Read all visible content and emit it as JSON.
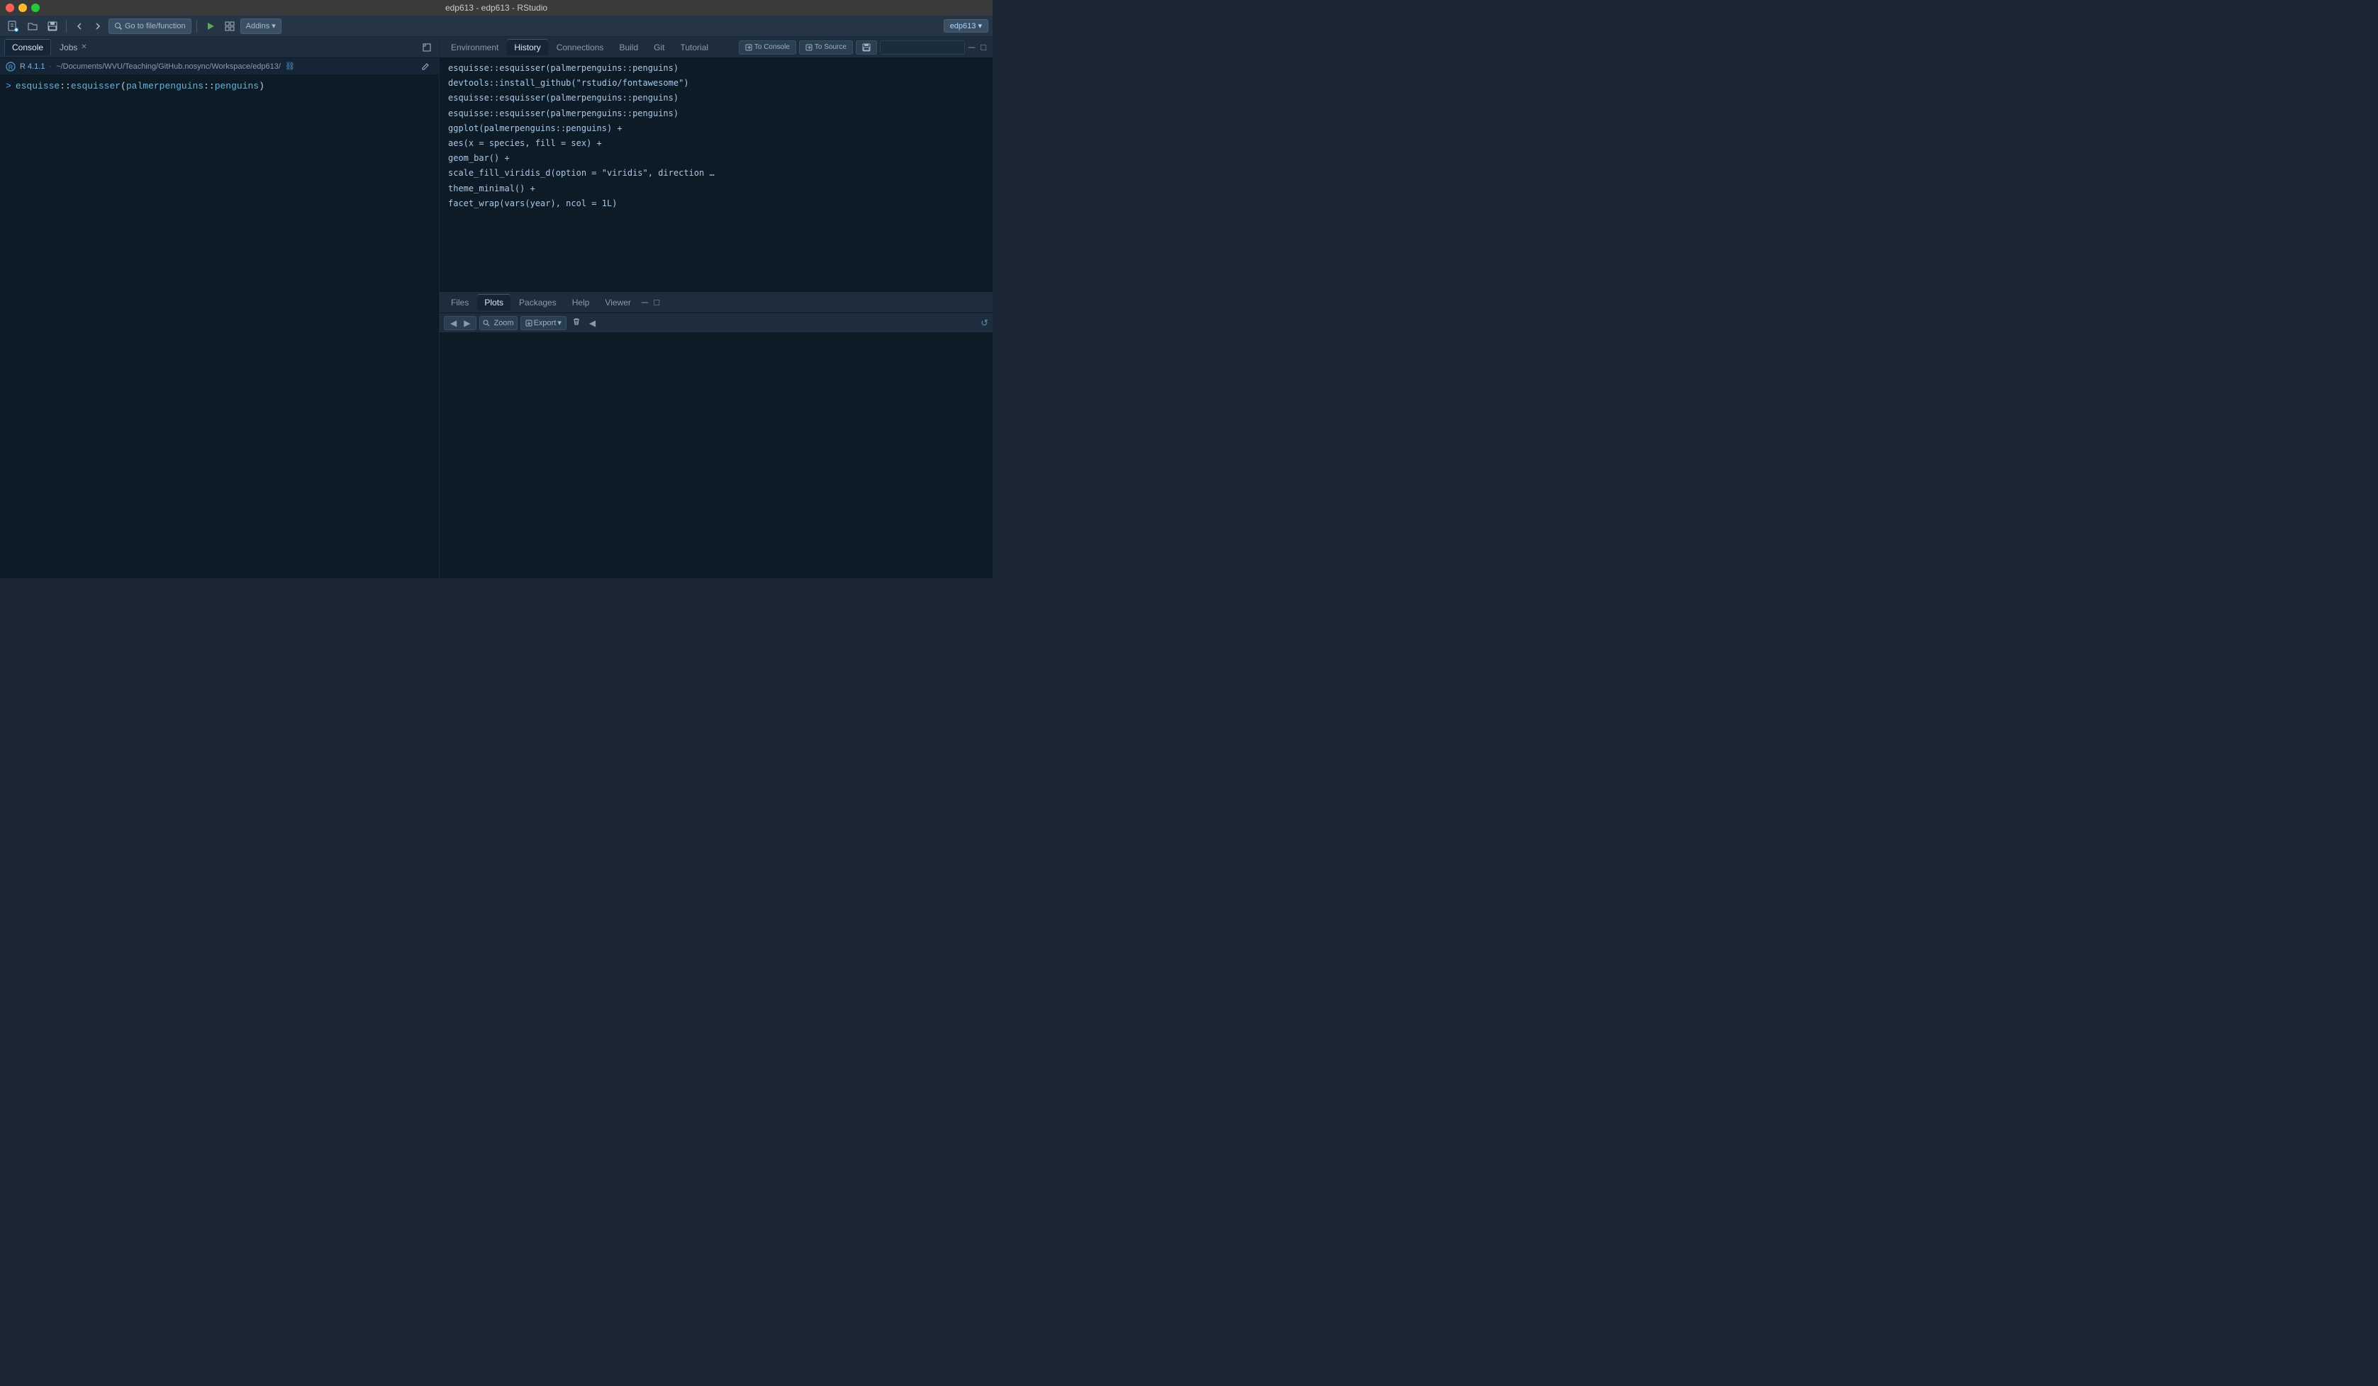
{
  "titleBar": {
    "title": "edp613 - edp613 - RStudio",
    "trafficLights": [
      "close",
      "minimize",
      "maximize"
    ]
  },
  "toolbar": {
    "newFile": "🆕",
    "openFile": "📂",
    "save": "💾",
    "goToFile": "Go to file/function",
    "addins": "Addins",
    "addinsArrow": "▾",
    "projectName": "edp613",
    "projectArrow": "▾"
  },
  "leftPanel": {
    "tabs": [
      {
        "label": "Console",
        "active": true
      },
      {
        "label": "Jobs",
        "active": false,
        "closeable": true
      }
    ],
    "pathBar": {
      "rVersion": "R 4.1.1",
      "path": "~/Documents/WVU/Teaching/GitHub.nosync/Workspace/edp613/",
      "hasLink": true
    },
    "console": {
      "prompt": ">",
      "command": "esquisse::esquisser(palmerpenguins::penguins)"
    }
  },
  "rightTopPanel": {
    "tabs": [
      {
        "label": "Environment",
        "active": false
      },
      {
        "label": "History",
        "active": true
      },
      {
        "label": "Connections",
        "active": false
      },
      {
        "label": "Build",
        "active": false
      },
      {
        "label": "Git",
        "active": false
      },
      {
        "label": "Tutorial",
        "active": false
      }
    ],
    "actions": {
      "toConsole": "To Console",
      "toSource": "To Source",
      "saveIcon": "💾"
    },
    "historyItems": [
      "esquisse::esquisser(palmerpenguins::penguins)",
      "devtools::install_github(\"rstudio/fontawesome\")",
      "esquisse::esquisser(palmerpenguins::penguins)",
      "esquisse::esquisser(palmerpenguins::penguins)",
      "ggplot(palmerpenguins::penguins) +",
      "aes(x = species, fill = sex) +",
      "geom_bar() +",
      "scale_fill_viridis_d(option = \"viridis\", direction …",
      "theme_minimal() +",
      "facet_wrap(vars(year), ncol = 1L)"
    ]
  },
  "rightBottomPanel": {
    "tabs": [
      {
        "label": "Files",
        "active": false
      },
      {
        "label": "Plots",
        "active": true
      },
      {
        "label": "Packages",
        "active": false
      },
      {
        "label": "Help",
        "active": false
      },
      {
        "label": "Viewer",
        "active": false
      }
    ],
    "toolbar": {
      "back": "◀",
      "forward": "▶",
      "zoom": "Zoom",
      "export": "Export",
      "exportArrow": "▾",
      "deleteButton": "🗑",
      "scrollLeft": "◀"
    }
  }
}
